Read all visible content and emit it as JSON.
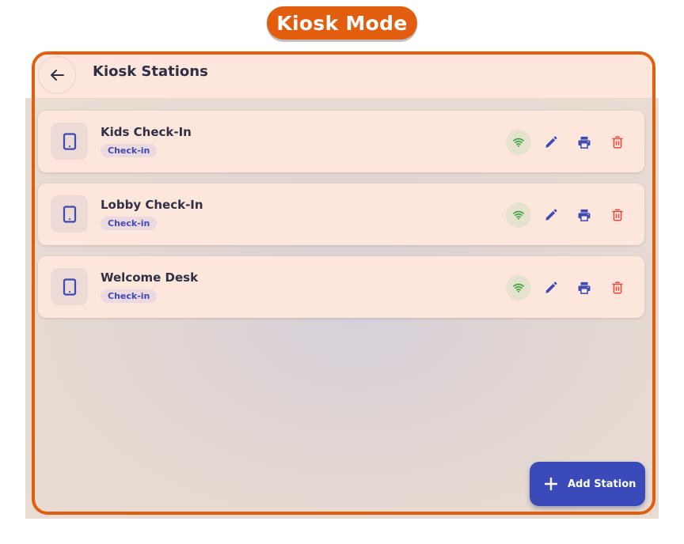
{
  "badge": {
    "label": "Kiosk Mode"
  },
  "header": {
    "title": "Kiosk Stations"
  },
  "stations": [
    {
      "name": "Kids Check-In",
      "tag": "Check-in"
    },
    {
      "name": "Lobby Check-In",
      "tag": "Check-in"
    },
    {
      "name": "Welcome Desk",
      "tag": "Check-in"
    }
  ],
  "fab": {
    "label": "Add Station"
  },
  "colors": {
    "accent": "#e25d0d",
    "primary": "#3a4ab8",
    "wifi": "#3da43d",
    "delete": "#e8453c",
    "card_bg": "#fde7dc"
  },
  "icons": {
    "back": "arrow-left-icon",
    "device": "tablet-icon",
    "wifi": "wifi-icon",
    "edit": "pencil-icon",
    "print": "printer-icon",
    "delete": "trash-icon",
    "add": "plus-icon"
  }
}
